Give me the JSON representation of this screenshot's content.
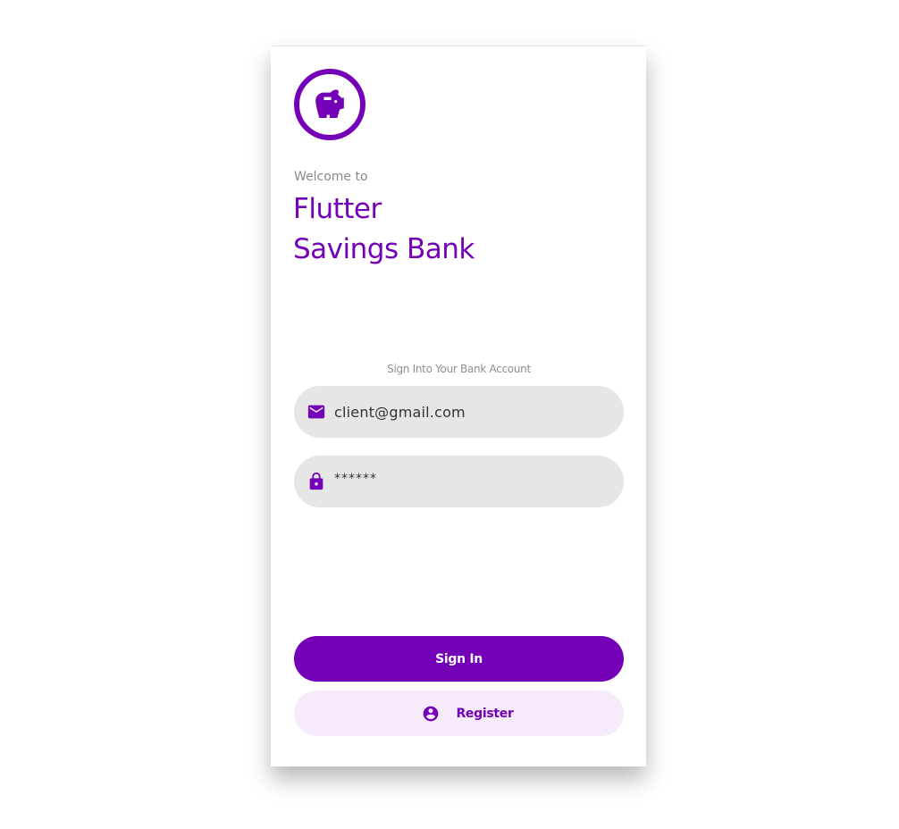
{
  "brand": {
    "accent_color": "#7400b8",
    "logo_icon": "piggy-bank-icon"
  },
  "header": {
    "welcome": "Welcome to",
    "title_line1": "Flutter",
    "title_line2": "Savings Bank"
  },
  "form": {
    "subtitle": "Sign Into Your Bank Account",
    "email": {
      "icon": "mail-icon",
      "value": "client@gmail.com"
    },
    "password": {
      "icon": "lock-icon",
      "value": "******"
    }
  },
  "actions": {
    "sign_in_label": "Sign In",
    "register_label": "Register",
    "register_icon": "account-circle-icon"
  }
}
